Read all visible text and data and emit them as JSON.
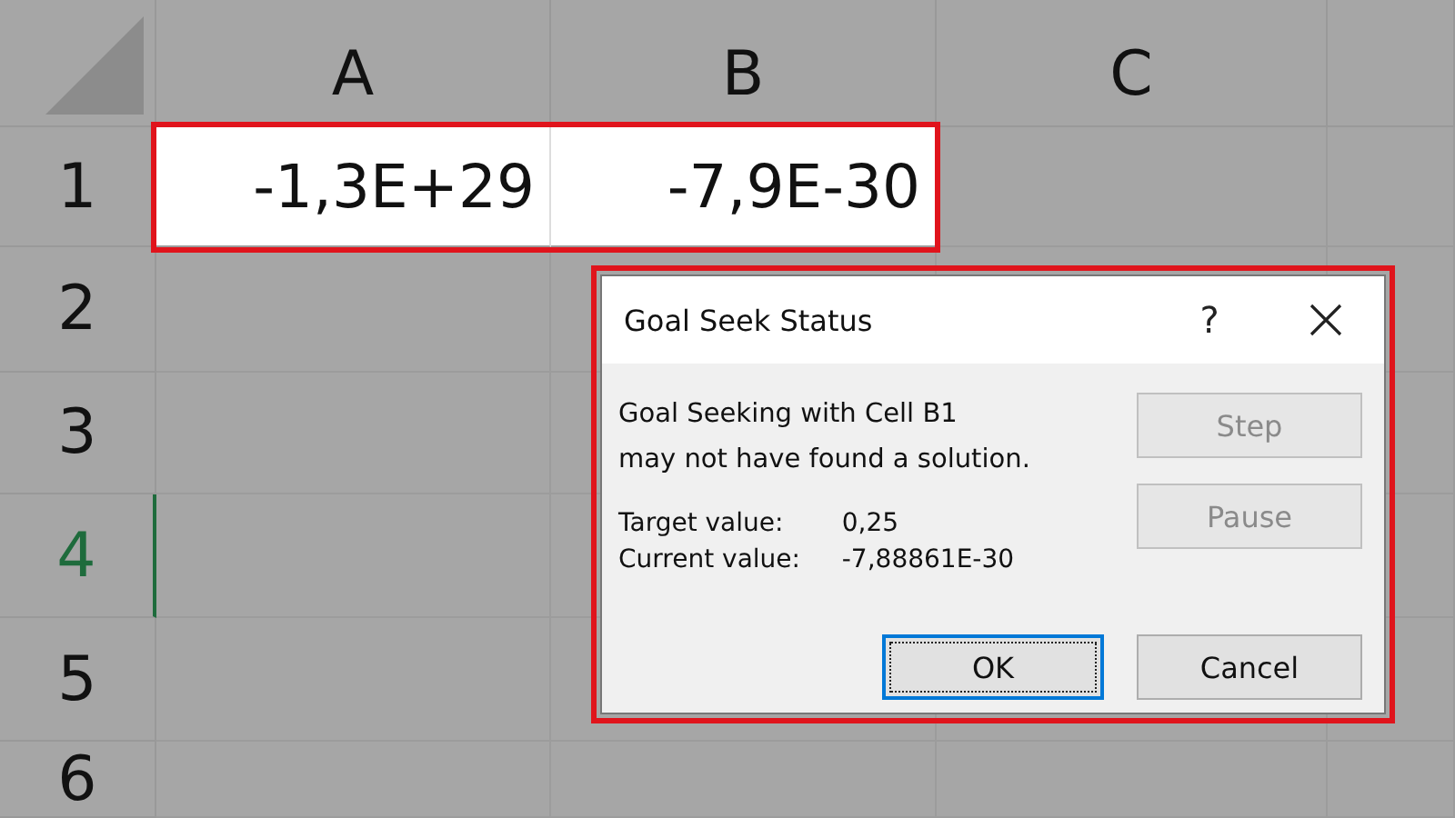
{
  "sheet": {
    "columns": [
      "A",
      "B",
      "C"
    ],
    "rows": [
      {
        "header": "1",
        "selected": false,
        "cells": [
          "-1,3E+29",
          "-7,9E-30"
        ]
      },
      {
        "header": "2",
        "selected": false
      },
      {
        "header": "3",
        "selected": false
      },
      {
        "header": "4",
        "selected": true
      },
      {
        "header": "5",
        "selected": false
      },
      {
        "header": "6",
        "selected": false
      }
    ]
  },
  "dialog": {
    "title": "Goal Seek Status",
    "help": "?",
    "message": [
      "Goal Seeking with Cell B1",
      "may not have found a solution."
    ],
    "fields": [
      {
        "label": "Target value:",
        "value": "0,25"
      },
      {
        "label": "Current value:",
        "value": "-7,88861E-30"
      }
    ],
    "side_buttons": [
      {
        "label": "Step",
        "disabled": true
      },
      {
        "label": "Pause",
        "disabled": true
      }
    ],
    "buttons": [
      {
        "label": "OK",
        "focused": true
      },
      {
        "label": "Cancel",
        "focused": false
      }
    ]
  }
}
